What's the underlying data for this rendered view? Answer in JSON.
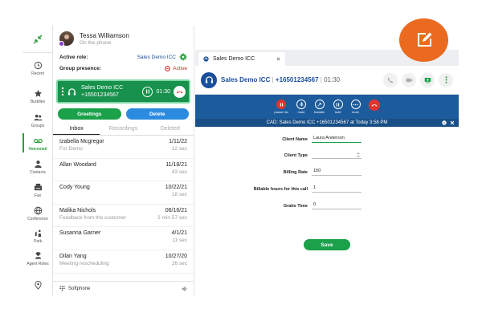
{
  "nav": {
    "items": [
      {
        "label": "Recent",
        "icon": "clock-icon"
      },
      {
        "label": "Buddies",
        "icon": "star-icon"
      },
      {
        "label": "Groups",
        "icon": "groups-icon"
      },
      {
        "label": "Voicemail",
        "icon": "voicemail-icon"
      },
      {
        "label": "Contacts",
        "icon": "contacts-icon"
      },
      {
        "label": "Fax",
        "icon": "fax-icon"
      },
      {
        "label": "Conference",
        "icon": "globe-icon"
      },
      {
        "label": "Park",
        "icon": "park-icon"
      },
      {
        "label": "Agent Roles",
        "icon": "agent-icon"
      }
    ]
  },
  "user": {
    "name": "Tessa Williamson",
    "status": "On the phone"
  },
  "role": {
    "label": "Active role:",
    "value": "Sales Demo ICC"
  },
  "presence": {
    "label": "Group presence:",
    "value": "Active"
  },
  "call": {
    "name": "Sales Demo ICC",
    "number": "+16501234567",
    "timer": "01:30"
  },
  "buttons": {
    "greetings": "Greetings",
    "delete": "Delete"
  },
  "tabs": [
    "Inbox",
    "Recordings",
    "Deleted"
  ],
  "messages": [
    {
      "name": "Izabella Mcgregor",
      "date": "1/11/22",
      "note": "For Demo",
      "duration": "12 sec"
    },
    {
      "name": "Allan Woodard",
      "date": "11/18/21",
      "note": "",
      "duration": "43 sec"
    },
    {
      "name": "Cody Young",
      "date": "10/22/21",
      "note": "",
      "duration": "18 sec"
    },
    {
      "name": "Malika Nichols",
      "date": "06/16/21",
      "note": "Feedback from the customer",
      "duration": "2 min 57 sec"
    },
    {
      "name": "Susanna Garner",
      "date": "4/1/21",
      "note": "",
      "duration": "11 sec"
    },
    {
      "name": "Dilan Yang",
      "date": "10/27/20",
      "note": "Meeting rescheduling",
      "duration": "26 sec"
    }
  ],
  "footer": {
    "label": "Softphone"
  },
  "main": {
    "tab_title": "Sales Demo ICC",
    "header_name": "Sales Demo ICC",
    "header_number": "+16501234567",
    "header_timer": "01:30",
    "controls": [
      "pause rec",
      "mute",
      "transfer",
      "hold",
      "more"
    ],
    "cad_text": "CAD: Sales Demo ICC +16501234567 at Today 3:58 PM",
    "form": [
      {
        "label": "Client Name",
        "value": "Laura Anderson"
      },
      {
        "label": "Client Type",
        "value": ""
      },
      {
        "label": "Billing Rate",
        "value": "150"
      },
      {
        "label": "Billable hours for this call",
        "value": "1"
      },
      {
        "label": "Gratis Time",
        "value": "0"
      }
    ],
    "save": "Save"
  },
  "colors": {
    "green": "#1aa14a",
    "blue": "#1d5c9c",
    "orange": "#ea6a1f",
    "red": "#e0342f"
  }
}
